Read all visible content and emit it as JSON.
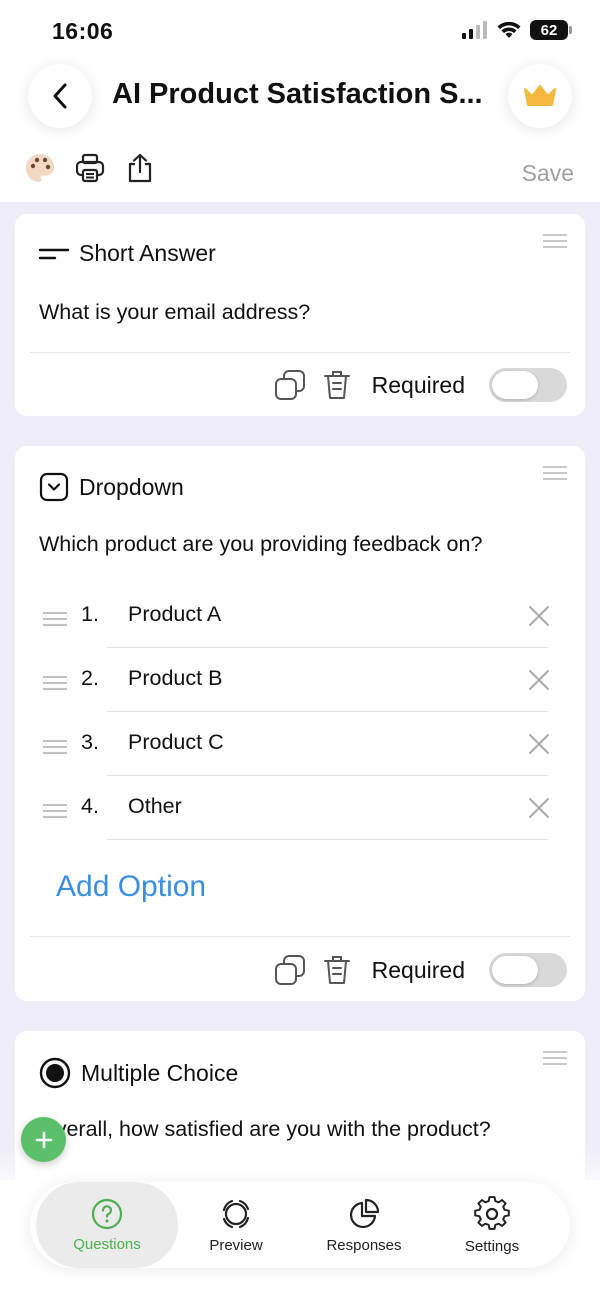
{
  "status": {
    "time": "16:06",
    "battery": "62"
  },
  "header": {
    "title": "AI Product Satisfaction S...",
    "save_label": "Save"
  },
  "cards": [
    {
      "type_label": "Short Answer",
      "question": "What is your email address?",
      "required_label": "Required"
    },
    {
      "type_label": "Dropdown",
      "question": "Which product are you providing feedback on?",
      "options": [
        {
          "num": "1.",
          "label": "Product A"
        },
        {
          "num": "2.",
          "label": "Product B"
        },
        {
          "num": "3.",
          "label": "Product C"
        },
        {
          "num": "4.",
          "label": "Other"
        }
      ],
      "add_option_label": "Add Option",
      "required_label": "Required"
    },
    {
      "type_label": "Multiple Choice",
      "question": "Overall, how satisfied are you with the product?"
    }
  ],
  "tabs": [
    {
      "label": "Questions",
      "active": true
    },
    {
      "label": "Preview"
    },
    {
      "label": "Responses"
    },
    {
      "label": "Settings"
    }
  ],
  "colors": {
    "accent": "#3a8fe0",
    "active_tab": "#4caf50",
    "fab": "#5cc06a",
    "background": "#efedf8",
    "crown": "#f5b83d"
  }
}
